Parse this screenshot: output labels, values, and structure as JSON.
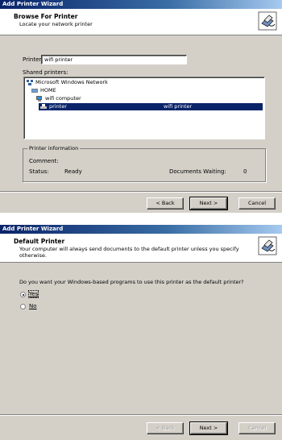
{
  "window1": {
    "title": "Add Printer Wizard",
    "header_title": "Browse For Printer",
    "header_subtitle": "Locate your network printer",
    "printer_label": "Printer:",
    "printer_value": "wifi printer",
    "shared_label": "Shared printers:",
    "tree": [
      {
        "label": "Microsoft Windows Network",
        "comment": ""
      },
      {
        "label": "HOME",
        "comment": ""
      },
      {
        "label": "wifi computer",
        "comment": ""
      },
      {
        "label": "printer",
        "comment": "wifi printer",
        "selected": true
      }
    ],
    "info": {
      "group_title": "Printer information",
      "comment_label": "Comment:",
      "comment_value": "",
      "status_label": "Status:",
      "status_value": "Ready",
      "docs_label": "Documents Waiting:",
      "docs_value": "0"
    },
    "buttons": {
      "back": "< Back",
      "next": "Next >",
      "cancel": "Cancel"
    }
  },
  "window2": {
    "title": "Add Printer Wizard",
    "header_title": "Default Printer",
    "header_subtitle": "Your computer will always send documents to the default printer unless you specify otherwise.",
    "question": "Do you want your Windows-based programs to use this printer as the default printer?",
    "options": [
      {
        "label": "Yes",
        "selected": true
      },
      {
        "label": "No",
        "selected": false
      }
    ],
    "buttons": {
      "back": "< Back",
      "next": "Next >",
      "cancel": "Cancel"
    }
  },
  "icons": [
    "printer-wizard-icon",
    "network-icon",
    "workgroup-icon",
    "computer-icon",
    "printer-icon"
  ]
}
